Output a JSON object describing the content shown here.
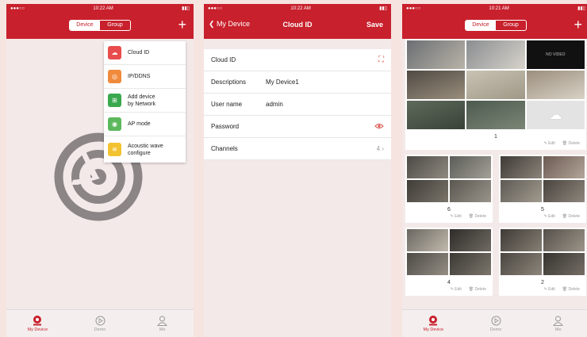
{
  "status": {
    "time": "10:22 AM",
    "time_p2": "10:22 AM",
    "time_p3": "10:21 AM"
  },
  "screen1": {
    "seg_device": "Device",
    "seg_group": "Group",
    "menu": [
      {
        "label_line1": "Cloud ID",
        "label_line2": "",
        "color": "#e84c4c"
      },
      {
        "label_line1": "IP/DDNS",
        "label_line2": "",
        "color": "#f08a3c"
      },
      {
        "label_line1": "Add device",
        "label_line2": "by Network",
        "color": "#3aa84e"
      },
      {
        "label_line1": "AP mode",
        "label_line2": "",
        "color": "#5cb85c"
      },
      {
        "label_line1": "Acoustic wave",
        "label_line2": "configure",
        "color": "#f2c230"
      }
    ]
  },
  "screen2": {
    "back": "My Device",
    "title": "Cloud ID",
    "save": "Save",
    "fields": [
      {
        "label": "Cloud ID",
        "value": ""
      },
      {
        "label": "Descriptions",
        "value": "My Device1"
      },
      {
        "label": "User name",
        "value": "admin"
      },
      {
        "label": "Password",
        "value": ""
      },
      {
        "label": "Channels",
        "value": ""
      }
    ],
    "channels_count": "4"
  },
  "screen3": {
    "seg_device": "Device",
    "seg_group": "Group",
    "no_video": "NO VIDEO",
    "cards": [
      {
        "number": "1",
        "edit": "Edit",
        "delete": "Delete"
      },
      {
        "number": "6",
        "edit": "Edit",
        "delete": "Delete"
      },
      {
        "number": "5",
        "edit": "Edit",
        "delete": "Delete"
      },
      {
        "number": "4",
        "edit": "Edit",
        "delete": "Delete"
      },
      {
        "number": "2",
        "edit": "Edit",
        "delete": "Delete"
      }
    ]
  },
  "tabs": {
    "my_device": "My Device",
    "demo": "Demo",
    "me": "Me"
  },
  "colors": {
    "brand": "#c8202c"
  }
}
